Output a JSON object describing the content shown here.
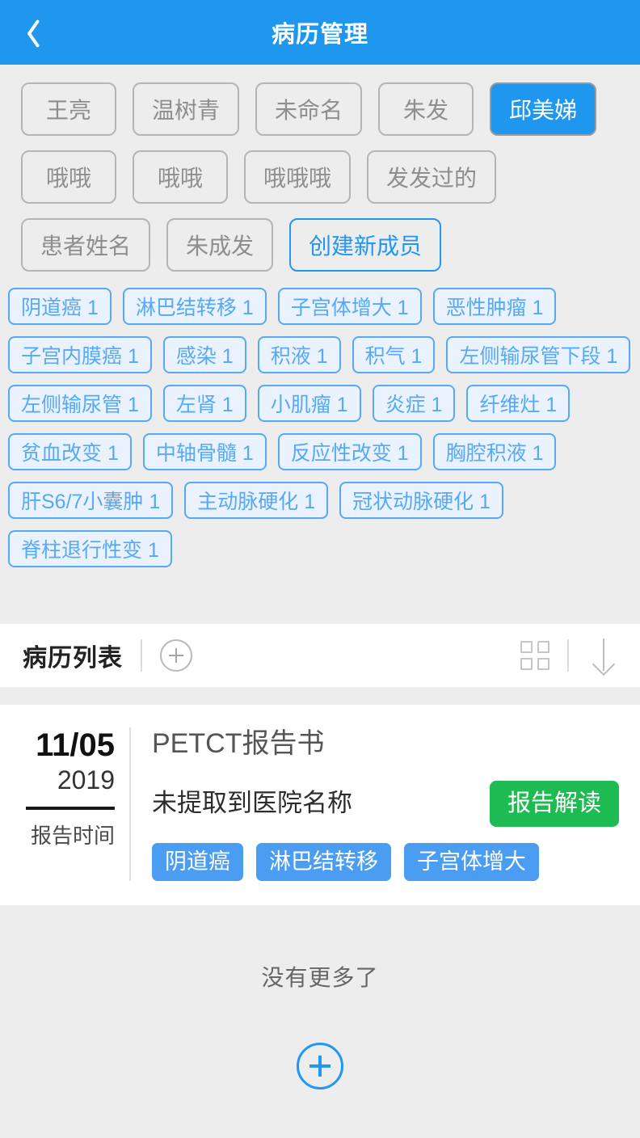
{
  "header": {
    "title": "病历管理",
    "back_icon": "chevron-left-icon",
    "bg_color": "#1f97ef"
  },
  "patients": {
    "items": [
      {
        "label": "王亮",
        "selected": false,
        "style": "default"
      },
      {
        "label": "温树青",
        "selected": false,
        "style": "default"
      },
      {
        "label": "未命名",
        "selected": false,
        "style": "default"
      },
      {
        "label": "朱发",
        "selected": false,
        "style": "default"
      },
      {
        "label": "邱美娣",
        "selected": true,
        "style": "default"
      },
      {
        "label": "哦哦",
        "selected": false,
        "style": "default"
      },
      {
        "label": "哦哦",
        "selected": false,
        "style": "default"
      },
      {
        "label": "哦哦哦",
        "selected": false,
        "style": "default"
      },
      {
        "label": "发发过的",
        "selected": false,
        "style": "default"
      },
      {
        "label": "患者姓名",
        "selected": false,
        "style": "default"
      },
      {
        "label": "朱成发",
        "selected": false,
        "style": "default"
      },
      {
        "label": "创建新成员",
        "selected": false,
        "style": "create"
      }
    ],
    "selected_color": "#1f97ef",
    "create_color": "#2196f3"
  },
  "tags": {
    "items": [
      "阴道癌 1",
      "淋巴结转移 1",
      "子宫体增大 1",
      "恶性肿瘤 1",
      "子宫内膜癌 1",
      "感染 1",
      "积液 1",
      "积气 1",
      "左侧输尿管下段 1",
      "左侧输尿管 1",
      "左肾 1",
      "小肌瘤 1",
      "炎症 1",
      "纤维灶 1",
      "贫血改变 1",
      "中轴骨髓 1",
      "反应性改变 1",
      "胸腔积液 1",
      "肝S6/7小囊肿 1",
      "主动脉硬化 1",
      "冠状动脉硬化 1",
      "脊柱退行性变 1"
    ],
    "border_color": "#56a9f5",
    "fill_color": "#eaf2fe"
  },
  "list_toolbar": {
    "title": "病历列表",
    "add_icon": "plus-circle-icon",
    "grid_icon": "grid-view-icon",
    "sort_icon": "arrow-down-icon"
  },
  "record": {
    "date_month_day": "11/05",
    "date_year": "2019",
    "date_label": "报告时间",
    "title": "PETCT报告书",
    "hospital": "未提取到医院名称",
    "action_label": "报告解读",
    "action_color": "#1ebb53",
    "tags": [
      "阴道癌",
      "淋巴结转移",
      "子宫体增大"
    ],
    "tag_color": "#4a9df0"
  },
  "footer": {
    "no_more_text": "没有更多了",
    "fab_icon": "plus-circle-icon",
    "fab_color": "#2196f3"
  }
}
